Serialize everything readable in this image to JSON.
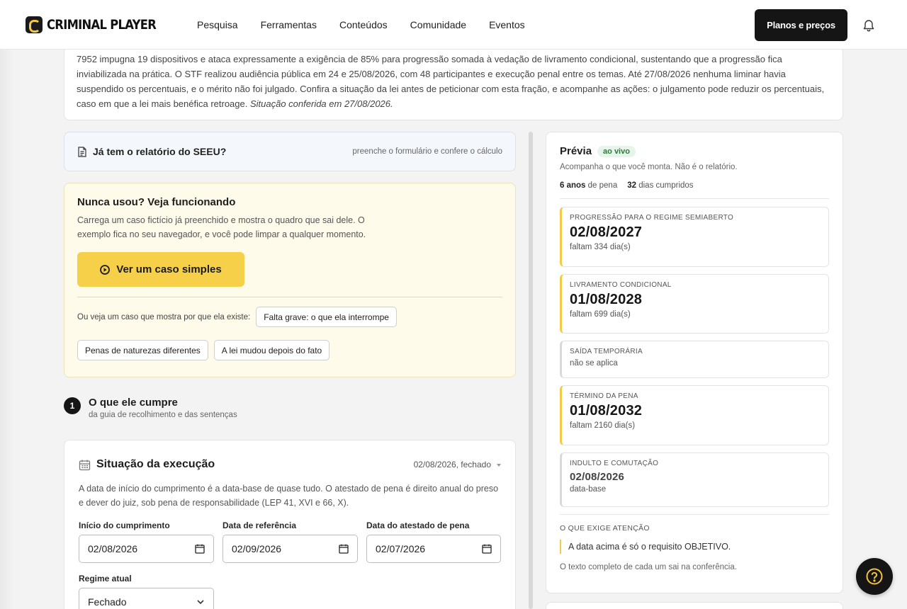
{
  "header": {
    "logo_text": "CRIMINAL PLAYER",
    "nav": [
      "Pesquisa",
      "Ferramentas",
      "Conteúdos",
      "Comunidade",
      "Eventos"
    ],
    "plans_label": "Planos e preços",
    "icons": {
      "logo": "criminal-player-logo-icon",
      "notifications": "bell-icon"
    }
  },
  "law_notice": {
    "text": "7952 impugna 19 dispositivos e ataca expressamente a exigência de 85% para progressão somada à vedação de livramento condicional, sustentando que a progressão fica inviabilizada na prática. O STF realizou audiência pública em 24 e 25/08/2026, com 48 participantes e execução penal entre os temas. Até 27/08/2026 nenhuma liminar havia suspendido os percentuais, e o mérito não foi julgado. Confira a situação da lei antes de peticionar com esta fração, e acompanhe as ações: o julgamento pode reduzir os percentuais, caso em que a lei mais benéfica retroage.",
    "checked": "Situação conferida em 27/08/2026."
  },
  "seeu": {
    "title": "Já tem o relatório do SEEU?",
    "hint": "preenche o formulário e confere o cálculo"
  },
  "demo": {
    "title": "Nunca usou? Veja funcionando",
    "text": "Carrega um caso fictício já preenchido e mostra o quadro que sai dele. O exemplo fica no seu navegador, e você pode limpar a qualquer momento.",
    "button_label": "Ver um caso simples",
    "chips_label": "Ou veja um caso que mostra por que ela existe:",
    "chips": [
      "Falta grave: o que ela interrompe",
      "Penas de naturezas diferentes",
      "A lei mudou depois do fato"
    ]
  },
  "step": {
    "number": "1",
    "title": "O que ele cumpre",
    "subtitle": "da guia de recolhimento e das sentenças"
  },
  "execution": {
    "title": "Situação da execução",
    "summary": "02/08/2026, fechado",
    "description": "A data de início do cumprimento é a data-base de quase tudo. O atestado de pena é direito anual do preso e dever do juiz, sob pena de responsabilidade (LEP 41, XVI e 66, X).",
    "fields": [
      {
        "label": "Início do cumprimento",
        "value": "02/08/2026"
      },
      {
        "label": "Data de referência",
        "value": "02/09/2026"
      },
      {
        "label": "Data do atestado de pena",
        "value": "02/07/2026"
      }
    ],
    "regime_label": "Regime atual",
    "regime_value": "Fechado"
  },
  "preview": {
    "title": "Prévia",
    "badge": "ao vivo",
    "subtitle": "Acompanha o que você monta. Não é o relatório.",
    "stats": {
      "years": "6 anos",
      "years_suffix": "de pena",
      "days": "32",
      "days_suffix": "dias cumpridos"
    },
    "milestones": [
      {
        "label": "PROGRESSÃO PARA O REGIME SEMIABERTO",
        "date": "02/08/2027",
        "note": "faltam 334 dia(s)"
      },
      {
        "label": "LIVRAMENTO CONDICIONAL",
        "date": "01/08/2028",
        "note": "faltam 699 dia(s)"
      },
      {
        "label": "SAÍDA TEMPORÁRIA",
        "note": "não se aplica"
      },
      {
        "label": "TÉRMINO DA PENA",
        "date": "01/08/2032",
        "note": "faltam 2160 dia(s)"
      },
      {
        "label": "INDULTO E COMUTAÇÃO",
        "date": "02/08/2026",
        "note": "data-base"
      }
    ],
    "attention_title": "O QUE EXIGE ATENÇÃO",
    "attention_item": "A data acima é só o requisito OBJETIVO.",
    "attention_footer": "O texto completo de cada um sai na conferência."
  },
  "colors": {
    "accent": "#f6d049",
    "dark": "#151515",
    "live": "#2f7a3d"
  }
}
